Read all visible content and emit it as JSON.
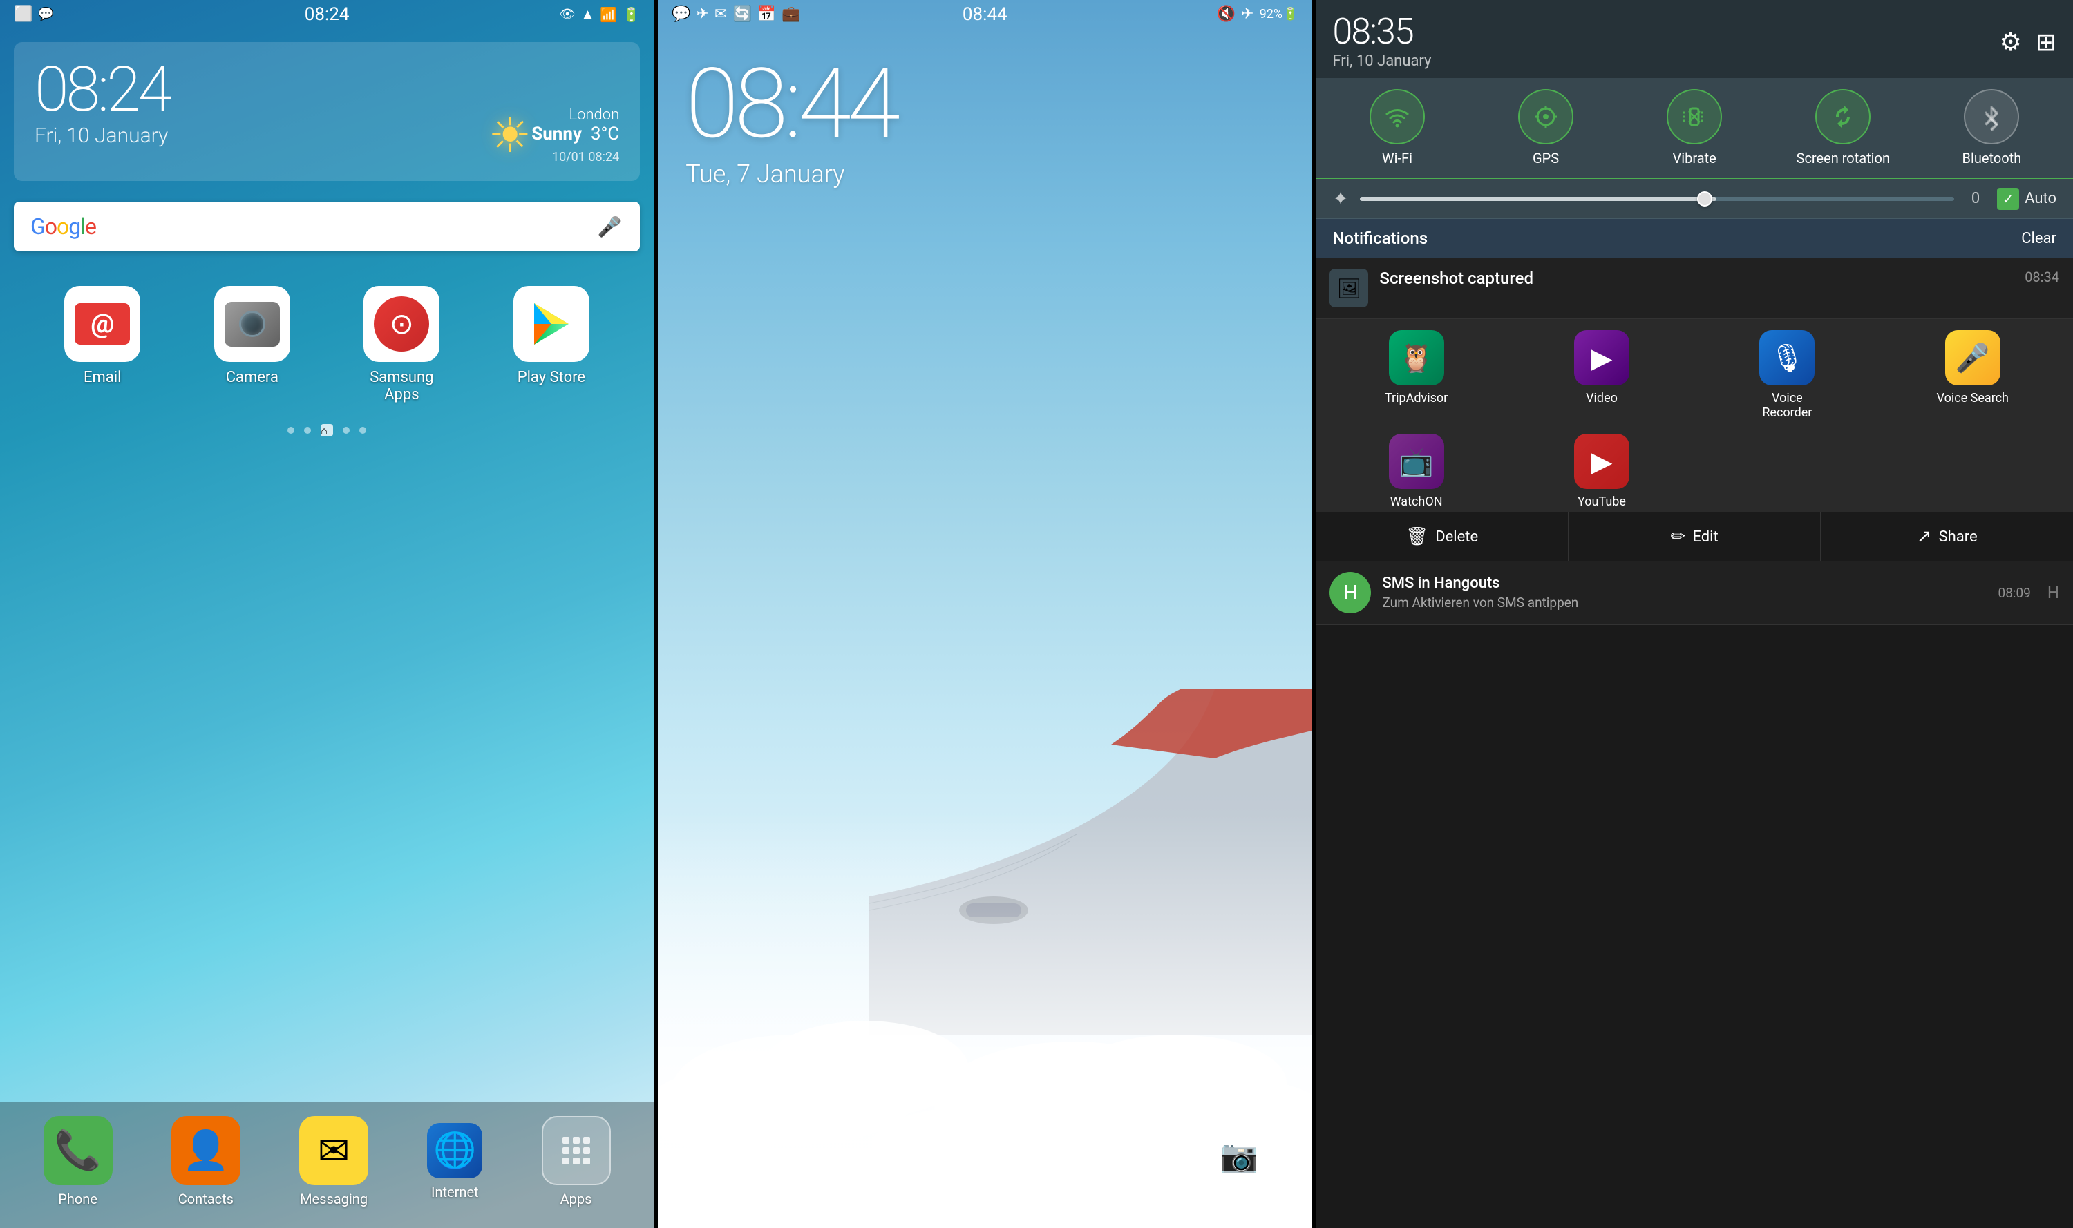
{
  "panel1": {
    "statusBar": {
      "time": "08:24"
    },
    "weather": {
      "time": "08:24",
      "date": "Fri, 10 January",
      "city": "London",
      "condition": "Sunny",
      "temp": "3°C",
      "timestamp": "10/01 08:24"
    },
    "googleSearch": {
      "placeholder": "Google",
      "micLabel": "microphone"
    },
    "apps": [
      {
        "label": "Email",
        "type": "email"
      },
      {
        "label": "Camera",
        "type": "camera"
      },
      {
        "label": "Samsung\nApps",
        "type": "samsung"
      },
      {
        "label": "Play Store",
        "type": "playstore"
      }
    ],
    "dock": [
      {
        "label": "Phone",
        "type": "phone"
      },
      {
        "label": "Contacts",
        "type": "contacts"
      },
      {
        "label": "Messaging",
        "type": "messaging"
      },
      {
        "label": "Internet",
        "type": "internet"
      },
      {
        "label": "Apps",
        "type": "apps"
      }
    ]
  },
  "panel2": {
    "statusBar": {
      "time": "08:44"
    },
    "time": "08:44",
    "date": "Tue, 7 January"
  },
  "panel3": {
    "header": {
      "time": "08:35",
      "date": "Fri, 10 January"
    },
    "toggles": [
      {
        "label": "Wi-Fi",
        "active": true,
        "icon": "wifi"
      },
      {
        "label": "GPS",
        "active": true,
        "icon": "gps"
      },
      {
        "label": "Vibrate",
        "active": true,
        "icon": "vibrate"
      },
      {
        "label": "Screen rotation",
        "active": true,
        "icon": "rotation"
      },
      {
        "label": "Bluetooth",
        "active": false,
        "icon": "bluetooth"
      }
    ],
    "brightness": {
      "value": "0",
      "autoLabel": "Auto"
    },
    "notifications": {
      "sectionTitle": "Notifications",
      "clearLabel": "Clear"
    },
    "screenshotNotif": {
      "title": "Screenshot captured",
      "time": "08:34"
    },
    "drawerApps": [
      {
        "label": "TripAdvisor",
        "type": "tripadvisor"
      },
      {
        "label": "Video",
        "type": "video"
      },
      {
        "label": "Voice\nRecorder",
        "type": "voicerecorder"
      },
      {
        "label": "Voice Search",
        "type": "voicesearch"
      },
      {
        "label": "WatchON",
        "type": "watchon"
      },
      {
        "label": "YouTube",
        "type": "youtube"
      }
    ],
    "actions": [
      {
        "label": "Delete",
        "icon": "trash"
      },
      {
        "label": "Edit",
        "icon": "pencil"
      },
      {
        "label": "Share",
        "icon": "share"
      }
    ],
    "smsNotif": {
      "title": "SMS in Hangouts",
      "body": "Zum Aktivieren von SMS antippen",
      "time": "08:09"
    }
  }
}
